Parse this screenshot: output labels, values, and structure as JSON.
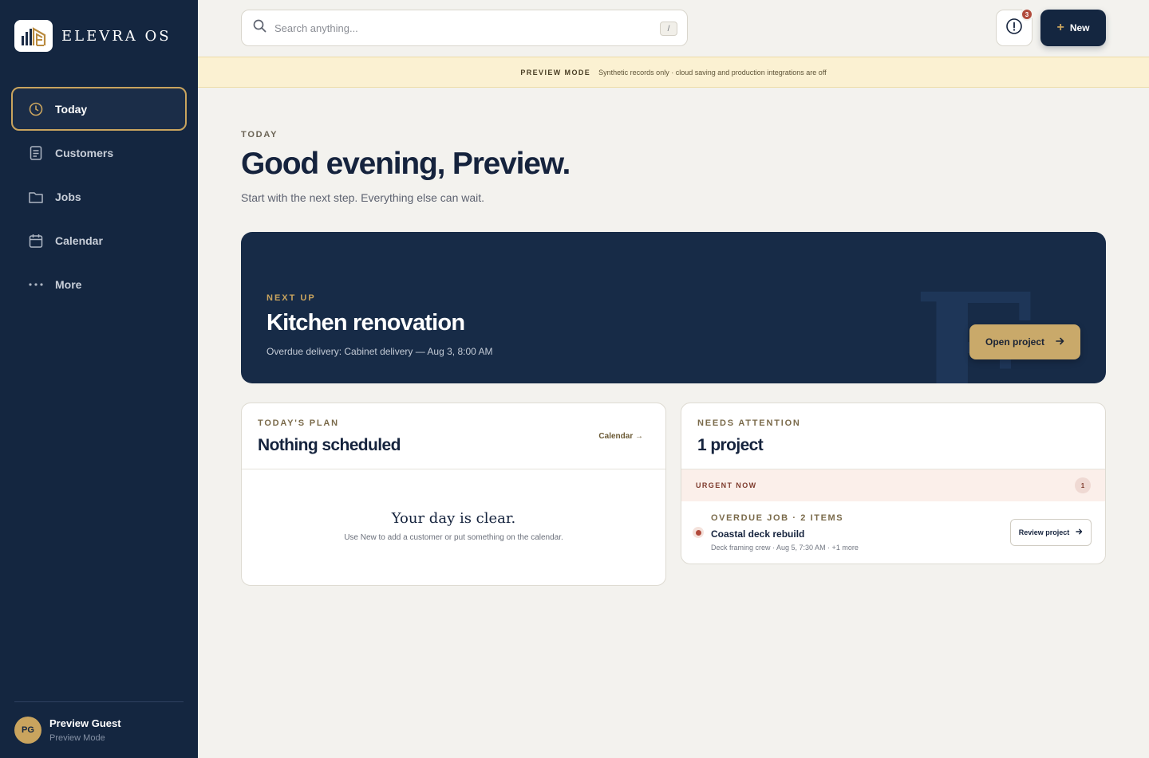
{
  "brand": {
    "name": "ELEVRA OS"
  },
  "sidebar": {
    "items": [
      {
        "label": "Today",
        "icon": "clock-icon",
        "active": true
      },
      {
        "label": "Customers",
        "icon": "document-icon"
      },
      {
        "label": "Jobs",
        "icon": "folder-icon"
      },
      {
        "label": "Calendar",
        "icon": "calendar-icon"
      },
      {
        "label": "More",
        "icon": "more-icon"
      }
    ],
    "user": {
      "initials": "PG",
      "name": "Preview Guest",
      "role": "Preview Mode"
    }
  },
  "topbar": {
    "search_placeholder": "Search anything...",
    "search_shortcut": "/",
    "notifications_count": "3",
    "new_label": "New"
  },
  "preview_banner": {
    "label": "PREVIEW MODE",
    "text": "Synthetic records only · cloud saving and production integrations are off"
  },
  "header": {
    "eyebrow": "TODAY",
    "greeting": "Good evening, Preview.",
    "subtitle": "Start with the next step. Everything else can wait."
  },
  "hero": {
    "eyebrow": "NEXT UP",
    "title": "Kitchen renovation",
    "subtitle": "Overdue delivery: Cabinet delivery — Aug 3, 8:00 AM",
    "button_label": "Open project",
    "watermark": "E"
  },
  "plan_card": {
    "eyebrow": "TODAY'S PLAN",
    "title": "Nothing scheduled",
    "link_label": "Calendar →",
    "empty_title": "Your day is clear.",
    "empty_subtitle": "Use New to add a customer or put something on the calendar."
  },
  "attention_card": {
    "eyebrow": "NEEDS ATTENTION",
    "title": "1 project",
    "urgent_label": "URGENT NOW",
    "urgent_count": "1",
    "job": {
      "eyebrow": "OVERDUE JOB · 2 ITEMS",
      "title": "Coastal deck rebuild",
      "meta": "Deck framing crew · Aug 5, 7:30 AM · +1 more",
      "button_label": "Review project"
    }
  },
  "colors": {
    "sidebar": "#142640",
    "accent_gold": "#c9a45e",
    "hero": "#172b47",
    "urgent": "#b14a3b",
    "banner": "#fbf1d2"
  }
}
